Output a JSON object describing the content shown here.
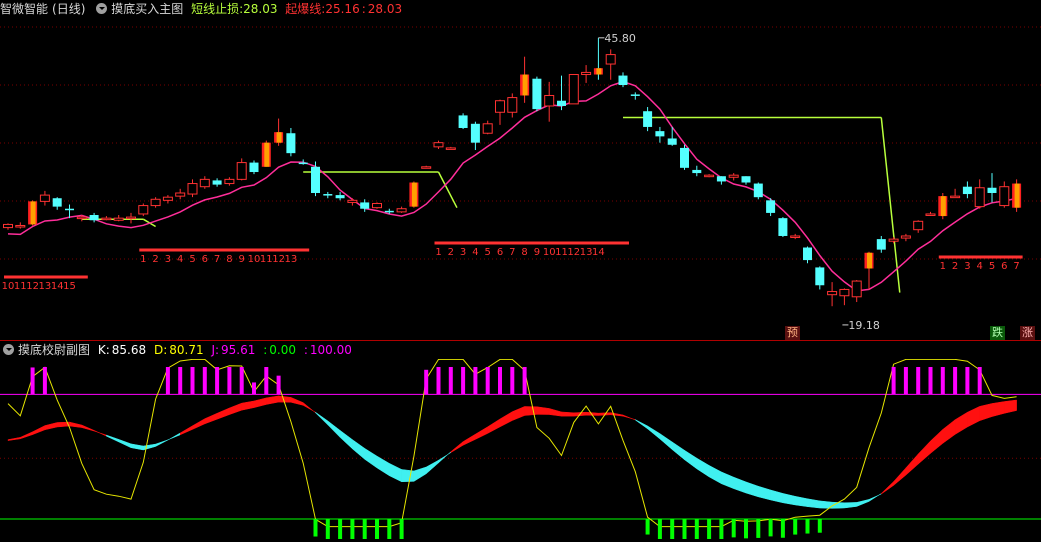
{
  "main": {
    "stock_name": "智微智能",
    "period": "(日线)",
    "indicator_name": "摸底买入主图",
    "stop_label": "短线止损:",
    "stop_value": "28.03",
    "burst_label": "起爆线:",
    "burst_value": "25.16",
    "burst_sep": ":",
    "burst_value2": "28.03",
    "high_price": "45.80",
    "low_price": "19.18",
    "tags": [
      "预",
      "跌",
      "涨"
    ]
  },
  "sub": {
    "indicator_name": "摸底校尉副图",
    "k_label": "K:",
    "k_value": "85.68",
    "d_label": "D:",
    "d_value": "80.71",
    "j_label": "J:",
    "j_value": "95.61",
    "sep1": ":",
    "v1": "0.00",
    "sep2": ":",
    "v2": "100.00"
  },
  "colors": {
    "up": "#ff3232",
    "down": "#54ffff",
    "ma": "#ff2e9a",
    "stopline": "#b8ff3c",
    "accent_yellow": "#ffff00",
    "accent_green": "#00ff00",
    "accent_magenta": "#ff00ff"
  },
  "chart_data": {
    "type": "candlestick",
    "candles": [
      [
        27.7,
        28.0,
        27.5,
        28.1
      ],
      [
        27.8,
        27.9,
        27.6,
        28.2
      ],
      [
        28.0,
        30.2,
        27.9,
        30.3
      ],
      [
        30.2,
        30.8,
        29.8,
        31.2
      ],
      [
        30.5,
        29.7,
        29.4,
        30.6
      ],
      [
        29.5,
        29.4,
        28.6,
        29.9
      ],
      [
        28.6,
        28.7,
        28.3,
        28.9
      ],
      [
        28.9,
        28.4,
        28.2,
        29.1
      ],
      [
        28.5,
        28.6,
        28.4,
        28.8
      ],
      [
        28.4,
        28.6,
        28.3,
        28.9
      ],
      [
        28.7,
        28.7,
        28.1,
        29.1
      ],
      [
        29.0,
        29.8,
        28.8,
        30.0
      ],
      [
        29.8,
        30.4,
        29.6,
        30.6
      ],
      [
        30.3,
        30.6,
        30.0,
        30.8
      ],
      [
        30.7,
        31.0,
        30.4,
        31.4
      ],
      [
        30.9,
        31.9,
        30.6,
        32.3
      ],
      [
        31.6,
        32.3,
        31.4,
        32.6
      ],
      [
        32.2,
        31.8,
        31.6,
        32.4
      ],
      [
        31.9,
        32.3,
        31.7,
        32.5
      ],
      [
        32.3,
        33.9,
        32.2,
        34.3
      ],
      [
        33.9,
        33.0,
        32.8,
        34.1
      ],
      [
        33.5,
        35.8,
        33.5,
        36.0
      ],
      [
        35.8,
        36.8,
        35.5,
        38.1
      ],
      [
        36.7,
        34.8,
        34.5,
        37.2
      ],
      [
        33.9,
        33.8,
        33.7,
        34.2
      ],
      [
        33.5,
        31.0,
        30.7,
        34.0
      ],
      [
        30.9,
        30.8,
        30.5,
        31.1
      ],
      [
        30.8,
        30.5,
        30.3,
        31.1
      ],
      [
        30.1,
        30.3,
        29.8,
        30.5
      ],
      [
        30.1,
        29.5,
        29.2,
        30.4
      ],
      [
        29.6,
        30.0,
        29.5,
        30.1
      ],
      [
        29.3,
        29.2,
        29.0,
        29.5
      ],
      [
        29.2,
        29.5,
        29.1,
        29.7
      ],
      [
        29.7,
        32.0,
        29.6,
        32.1
      ],
      [
        33.5,
        33.5,
        33.4,
        33.6
      ],
      [
        35.4,
        35.8,
        35.2,
        36.0
      ],
      [
        35.3,
        35.3,
        35.2,
        35.4
      ],
      [
        38.4,
        37.2,
        37.1,
        38.6
      ],
      [
        37.6,
        35.8,
        35.1,
        37.8
      ],
      [
        36.7,
        37.6,
        36.6,
        37.9
      ],
      [
        38.7,
        39.8,
        37.5,
        39.9
      ],
      [
        38.7,
        40.1,
        38.2,
        40.5
      ],
      [
        40.3,
        42.3,
        39.6,
        44.0
      ],
      [
        41.9,
        39.0,
        38.8,
        42.1
      ],
      [
        39.3,
        40.3,
        37.8,
        41.6
      ],
      [
        39.8,
        39.3,
        38.9,
        42.2
      ],
      [
        39.5,
        42.3,
        39.5,
        42.3
      ],
      [
        42.3,
        42.5,
        41.5,
        43.2
      ],
      [
        42.9,
        42.3,
        41.8,
        45.8
      ],
      [
        43.3,
        44.2,
        41.8,
        44.7
      ],
      [
        42.2,
        41.3,
        41.1,
        42.5
      ],
      [
        40.4,
        40.3,
        39.9,
        40.6
      ],
      [
        38.8,
        37.3,
        36.9,
        39.2
      ],
      [
        36.9,
        36.4,
        35.8,
        37.3
      ],
      [
        36.2,
        35.6,
        35.5,
        37.3
      ],
      [
        35.3,
        33.4,
        33.2,
        35.6
      ],
      [
        33.2,
        32.9,
        32.6,
        33.6
      ],
      [
        32.6,
        32.7,
        32.5,
        32.8
      ],
      [
        32.6,
        32.1,
        31.8,
        32.6
      ],
      [
        32.5,
        32.7,
        32.2,
        32.9
      ],
      [
        32.6,
        32.0,
        31.8,
        32.6
      ],
      [
        31.9,
        30.6,
        30.4,
        32.0
      ],
      [
        30.3,
        29.1,
        28.8,
        30.5
      ],
      [
        28.6,
        26.9,
        26.8,
        28.7
      ],
      [
        26.9,
        26.9,
        26.6,
        27.1
      ],
      [
        25.8,
        24.6,
        24.3,
        25.9
      ],
      [
        23.9,
        22.2,
        21.8,
        24.0
      ],
      [
        21.3,
        21.6,
        20.2,
        22.5
      ],
      [
        21.2,
        21.8,
        20.3,
        21.9
      ],
      [
        21.1,
        22.6,
        20.6,
        22.7
      ],
      [
        23.8,
        25.3,
        21.8,
        25.4
      ],
      [
        26.6,
        25.6,
        25.3,
        26.9
      ],
      [
        26.4,
        26.6,
        26.2,
        26.8
      ],
      [
        26.7,
        26.9,
        26.4,
        27.1
      ],
      [
        27.5,
        28.3,
        27.2,
        28.4
      ],
      [
        29.0,
        29.0,
        28.8,
        29.2
      ],
      [
        28.8,
        30.7,
        28.5,
        31.0
      ],
      [
        30.7,
        30.7,
        30.6,
        31.4
      ],
      [
        31.6,
        30.9,
        30.5,
        32.1
      ],
      [
        29.7,
        31.5,
        29.5,
        32.3
      ],
      [
        31.5,
        31.0,
        30.1,
        32.9
      ],
      [
        29.8,
        31.6,
        29.6,
        32.1
      ],
      [
        29.6,
        31.9,
        29.2,
        32.3
      ]
    ],
    "ma_type": "moving-average",
    "kdj": {
      "K": 85.68,
      "D": 80.71,
      "J": 95.61,
      "lower": 0.0,
      "upper": 100.0
    }
  }
}
